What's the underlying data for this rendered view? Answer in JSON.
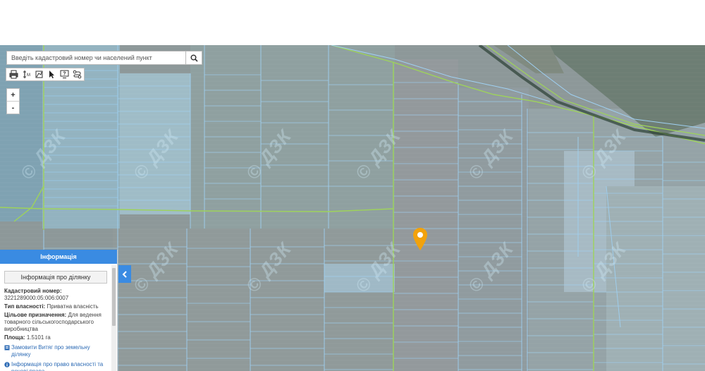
{
  "search": {
    "placeholder": "Введіть кадастровий номер чи населений пункт"
  },
  "zoom": {
    "in_label": "+",
    "out_label": "-"
  },
  "colors": {
    "accent": "#3a8be2",
    "parcel_line": "#9fd0f2",
    "boundary_line": "#9ed35a",
    "pin": "#f2a20c"
  },
  "info_panel": {
    "title": "Інформація",
    "subtitle": "Інформація про ділянку",
    "cadastral_label": "Кадастровий номер:",
    "cadastral_value": "3221289000:05:006:0007",
    "ownership_label": "Тип власності:",
    "ownership_value": "Приватна власність",
    "purpose_label": "Цільове призначення:",
    "purpose_value": "Для ведення товарного сільськогосподарського виробництва",
    "area_label": "Площа:",
    "area_value": "1.5101 га",
    "link_extract": "Замовити Витяг про земельну ділянку",
    "link_rights": "Інформація про право власності та речові права"
  },
  "watermark": "© ДЗК"
}
